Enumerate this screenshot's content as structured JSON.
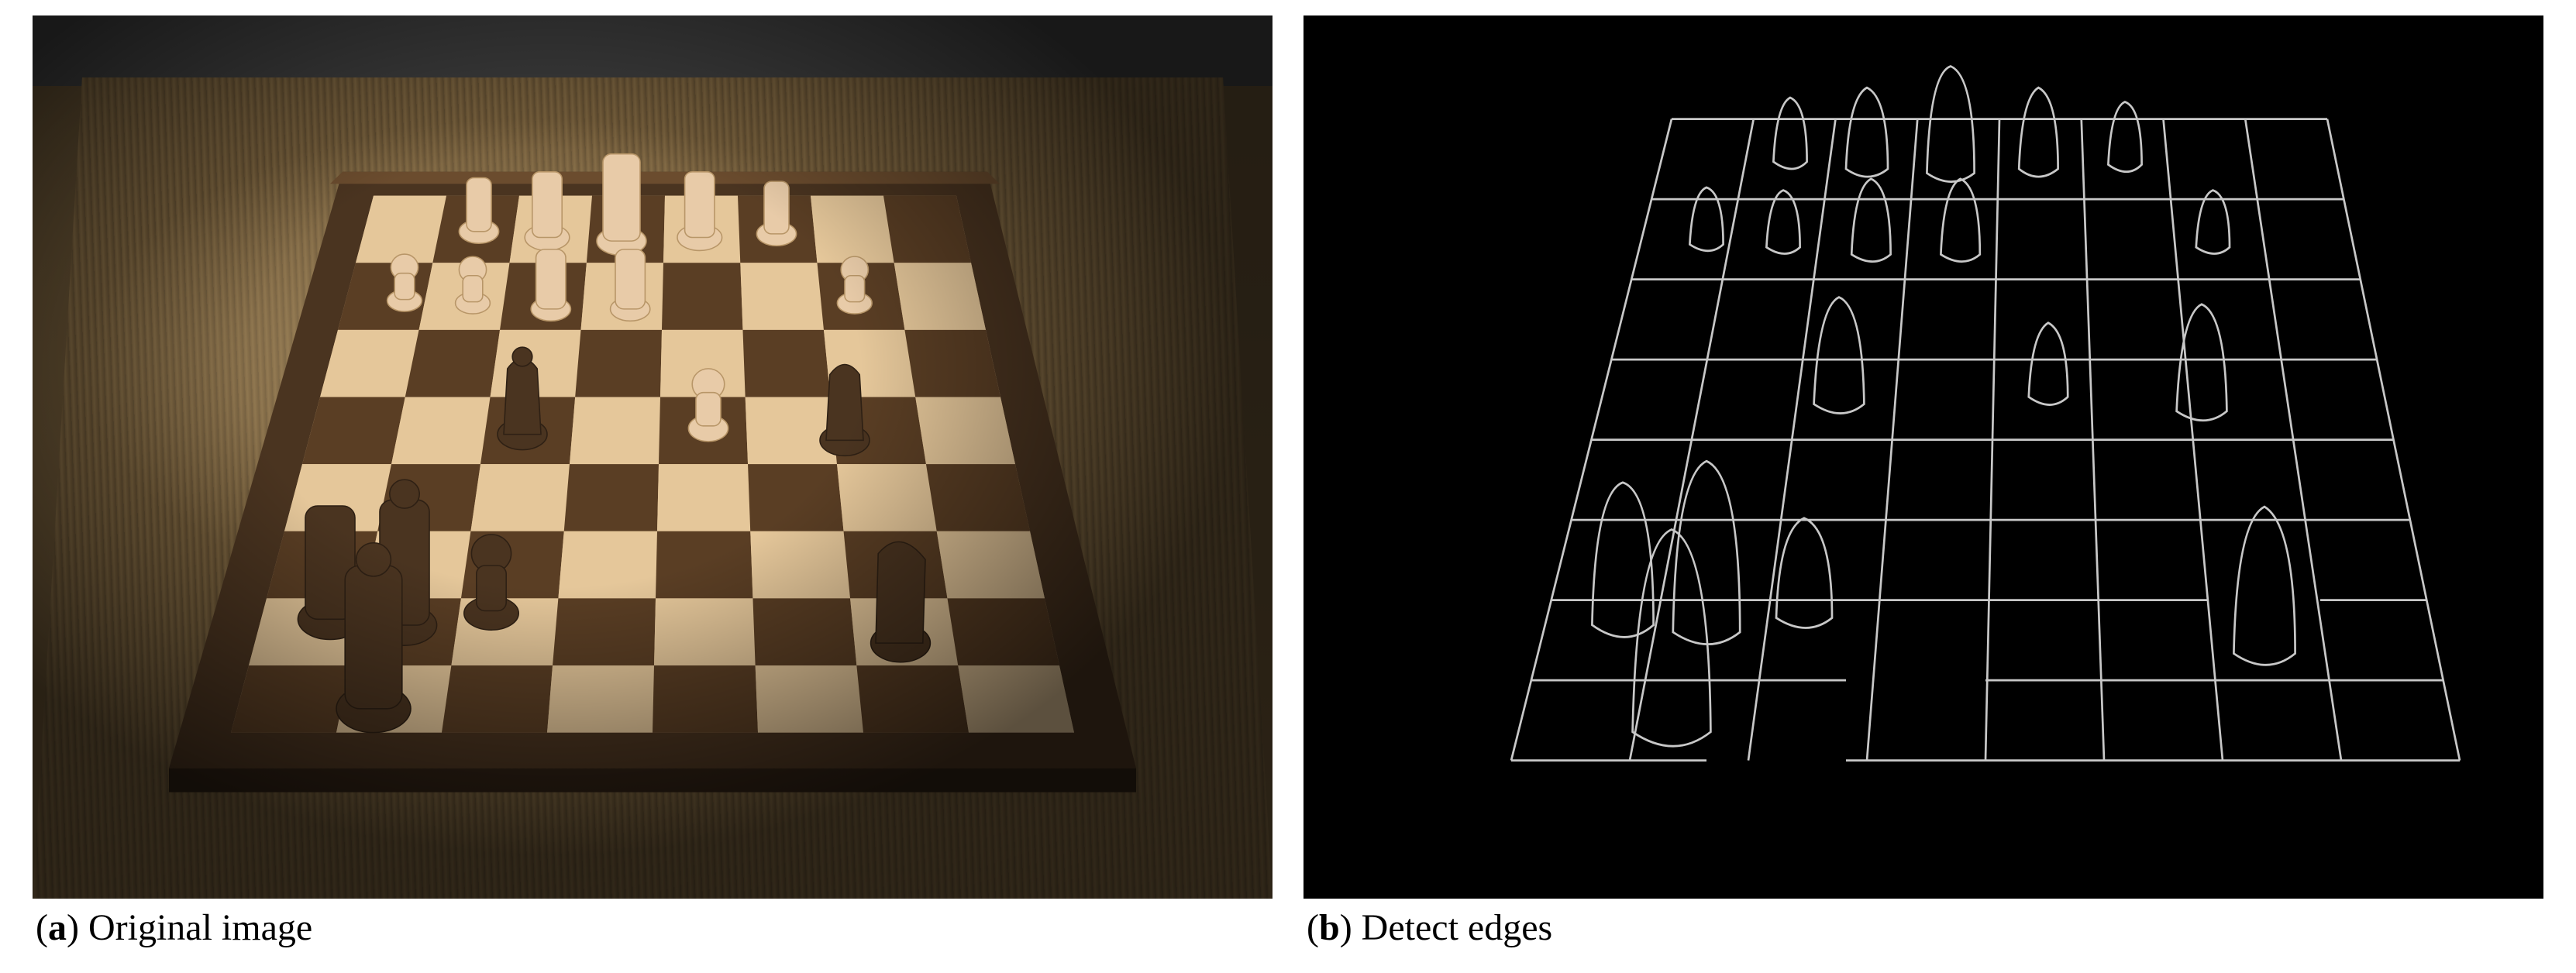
{
  "panels": [
    {
      "label": "a",
      "caption_prefix": "(",
      "caption_suffix": ") ",
      "caption_text": "Original image"
    },
    {
      "label": "b",
      "caption_prefix": "(",
      "caption_suffix": ") ",
      "caption_text": "Detect edges"
    }
  ]
}
